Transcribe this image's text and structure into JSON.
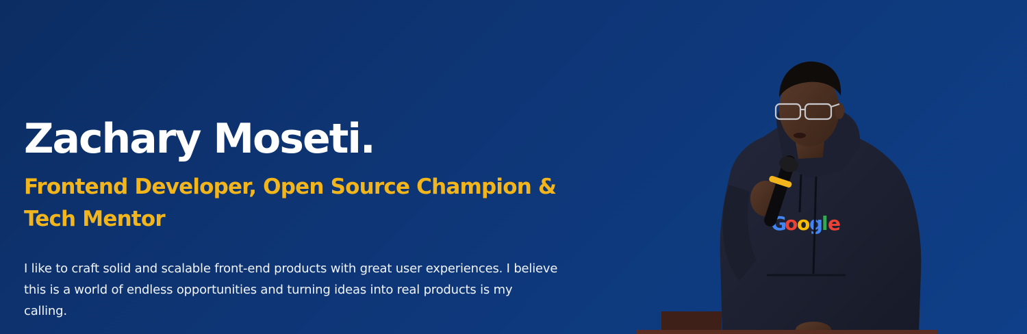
{
  "hero": {
    "name": "Zachary Moseti.",
    "role": "Frontend Developer, Open Source Champion & Tech Mentor",
    "bio": "I like to craft solid and scalable front-end products with great user experiences. I believe this is a world of endless opportunities and turning ideas into real products is my calling.",
    "photo": {
      "hoodie_logo": "Google",
      "icon": "person-speaking-with-microphone"
    }
  },
  "colors": {
    "background": "#0e3677",
    "name": "#ffffff",
    "role": "#f2b51c",
    "bio": "#f1f4fa",
    "google_blue": "#4285f4",
    "google_red": "#ea4335",
    "google_yellow": "#fbbc05",
    "google_green": "#34a853"
  }
}
